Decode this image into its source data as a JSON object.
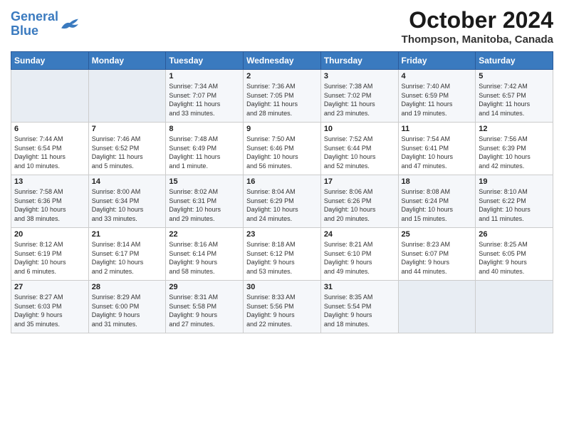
{
  "logo": {
    "line1": "General",
    "line2": "Blue"
  },
  "title": "October 2024",
  "location": "Thompson, Manitoba, Canada",
  "days_header": [
    "Sunday",
    "Monday",
    "Tuesday",
    "Wednesday",
    "Thursday",
    "Friday",
    "Saturday"
  ],
  "weeks": [
    [
      {
        "day": "",
        "info": ""
      },
      {
        "day": "",
        "info": ""
      },
      {
        "day": "1",
        "info": "Sunrise: 7:34 AM\nSunset: 7:07 PM\nDaylight: 11 hours\nand 33 minutes."
      },
      {
        "day": "2",
        "info": "Sunrise: 7:36 AM\nSunset: 7:05 PM\nDaylight: 11 hours\nand 28 minutes."
      },
      {
        "day": "3",
        "info": "Sunrise: 7:38 AM\nSunset: 7:02 PM\nDaylight: 11 hours\nand 23 minutes."
      },
      {
        "day": "4",
        "info": "Sunrise: 7:40 AM\nSunset: 6:59 PM\nDaylight: 11 hours\nand 19 minutes."
      },
      {
        "day": "5",
        "info": "Sunrise: 7:42 AM\nSunset: 6:57 PM\nDaylight: 11 hours\nand 14 minutes."
      }
    ],
    [
      {
        "day": "6",
        "info": "Sunrise: 7:44 AM\nSunset: 6:54 PM\nDaylight: 11 hours\nand 10 minutes."
      },
      {
        "day": "7",
        "info": "Sunrise: 7:46 AM\nSunset: 6:52 PM\nDaylight: 11 hours\nand 5 minutes."
      },
      {
        "day": "8",
        "info": "Sunrise: 7:48 AM\nSunset: 6:49 PM\nDaylight: 11 hours\nand 1 minute."
      },
      {
        "day": "9",
        "info": "Sunrise: 7:50 AM\nSunset: 6:46 PM\nDaylight: 10 hours\nand 56 minutes."
      },
      {
        "day": "10",
        "info": "Sunrise: 7:52 AM\nSunset: 6:44 PM\nDaylight: 10 hours\nand 52 minutes."
      },
      {
        "day": "11",
        "info": "Sunrise: 7:54 AM\nSunset: 6:41 PM\nDaylight: 10 hours\nand 47 minutes."
      },
      {
        "day": "12",
        "info": "Sunrise: 7:56 AM\nSunset: 6:39 PM\nDaylight: 10 hours\nand 42 minutes."
      }
    ],
    [
      {
        "day": "13",
        "info": "Sunrise: 7:58 AM\nSunset: 6:36 PM\nDaylight: 10 hours\nand 38 minutes."
      },
      {
        "day": "14",
        "info": "Sunrise: 8:00 AM\nSunset: 6:34 PM\nDaylight: 10 hours\nand 33 minutes."
      },
      {
        "day": "15",
        "info": "Sunrise: 8:02 AM\nSunset: 6:31 PM\nDaylight: 10 hours\nand 29 minutes."
      },
      {
        "day": "16",
        "info": "Sunrise: 8:04 AM\nSunset: 6:29 PM\nDaylight: 10 hours\nand 24 minutes."
      },
      {
        "day": "17",
        "info": "Sunrise: 8:06 AM\nSunset: 6:26 PM\nDaylight: 10 hours\nand 20 minutes."
      },
      {
        "day": "18",
        "info": "Sunrise: 8:08 AM\nSunset: 6:24 PM\nDaylight: 10 hours\nand 15 minutes."
      },
      {
        "day": "19",
        "info": "Sunrise: 8:10 AM\nSunset: 6:22 PM\nDaylight: 10 hours\nand 11 minutes."
      }
    ],
    [
      {
        "day": "20",
        "info": "Sunrise: 8:12 AM\nSunset: 6:19 PM\nDaylight: 10 hours\nand 6 minutes."
      },
      {
        "day": "21",
        "info": "Sunrise: 8:14 AM\nSunset: 6:17 PM\nDaylight: 10 hours\nand 2 minutes."
      },
      {
        "day": "22",
        "info": "Sunrise: 8:16 AM\nSunset: 6:14 PM\nDaylight: 9 hours\nand 58 minutes."
      },
      {
        "day": "23",
        "info": "Sunrise: 8:18 AM\nSunset: 6:12 PM\nDaylight: 9 hours\nand 53 minutes."
      },
      {
        "day": "24",
        "info": "Sunrise: 8:21 AM\nSunset: 6:10 PM\nDaylight: 9 hours\nand 49 minutes."
      },
      {
        "day": "25",
        "info": "Sunrise: 8:23 AM\nSunset: 6:07 PM\nDaylight: 9 hours\nand 44 minutes."
      },
      {
        "day": "26",
        "info": "Sunrise: 8:25 AM\nSunset: 6:05 PM\nDaylight: 9 hours\nand 40 minutes."
      }
    ],
    [
      {
        "day": "27",
        "info": "Sunrise: 8:27 AM\nSunset: 6:03 PM\nDaylight: 9 hours\nand 35 minutes."
      },
      {
        "day": "28",
        "info": "Sunrise: 8:29 AM\nSunset: 6:00 PM\nDaylight: 9 hours\nand 31 minutes."
      },
      {
        "day": "29",
        "info": "Sunrise: 8:31 AM\nSunset: 5:58 PM\nDaylight: 9 hours\nand 27 minutes."
      },
      {
        "day": "30",
        "info": "Sunrise: 8:33 AM\nSunset: 5:56 PM\nDaylight: 9 hours\nand 22 minutes."
      },
      {
        "day": "31",
        "info": "Sunrise: 8:35 AM\nSunset: 5:54 PM\nDaylight: 9 hours\nand 18 minutes."
      },
      {
        "day": "",
        "info": ""
      },
      {
        "day": "",
        "info": ""
      }
    ]
  ]
}
